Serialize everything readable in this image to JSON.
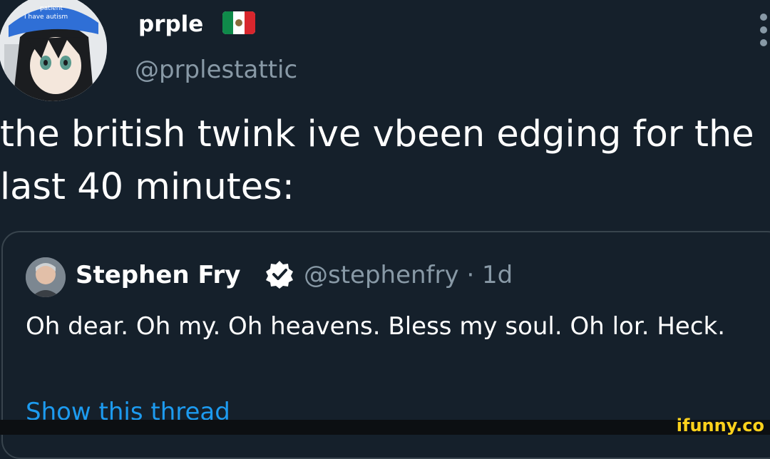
{
  "tweet": {
    "author": {
      "display_name": "prple",
      "handle": "@prplestattic",
      "flag_icon": "mexico-flag-icon"
    },
    "text": "the british twink ive vbeen edging for the last 40 minutes:"
  },
  "quoted_tweet": {
    "display_name": "Stephen Fry",
    "verified": true,
    "handle_time": "@stephenfry · 1d",
    "text": "Oh dear. Oh my. Oh heavens. Bless my soul. Oh lor. Heck.",
    "link": "Show this thread"
  },
  "watermark": "ifunny.co",
  "colors": {
    "background": "#15202b",
    "secondary_text": "#8899a6",
    "link": "#1d9bf0",
    "border": "#38444d"
  }
}
